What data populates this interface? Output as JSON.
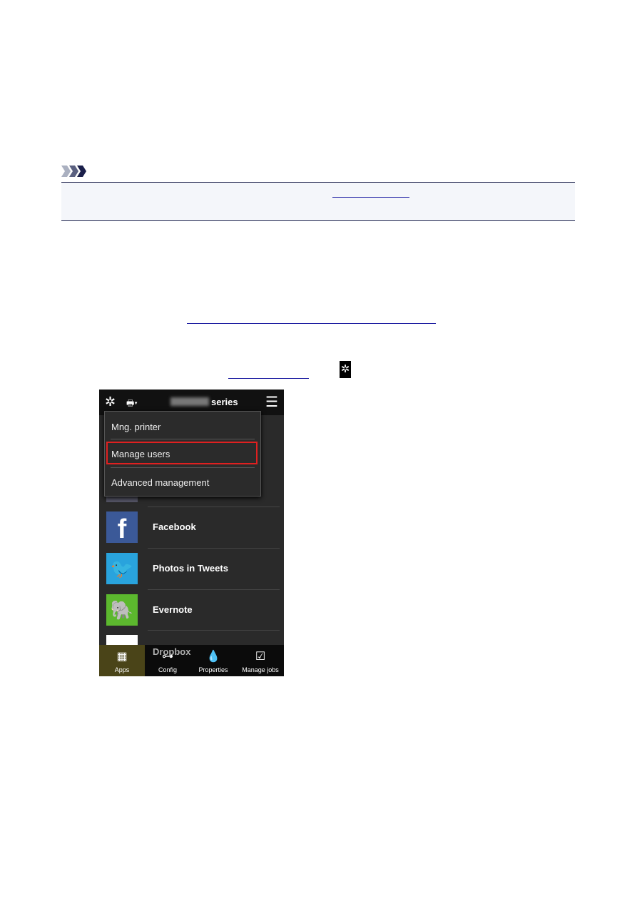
{
  "phone": {
    "title_suffix": "series",
    "menu": [
      "Mng. printer",
      "Manage users",
      "Advanced management"
    ],
    "highlighted_item": "Manage users",
    "apps": [
      "Facebook",
      "Photos in Tweets",
      "Evernote",
      "Dropbox"
    ],
    "tabs": [
      "Apps",
      "Config",
      "Properties",
      "Manage jobs"
    ],
    "active_tab": "Apps",
    "highlight_color": "#e02020"
  }
}
